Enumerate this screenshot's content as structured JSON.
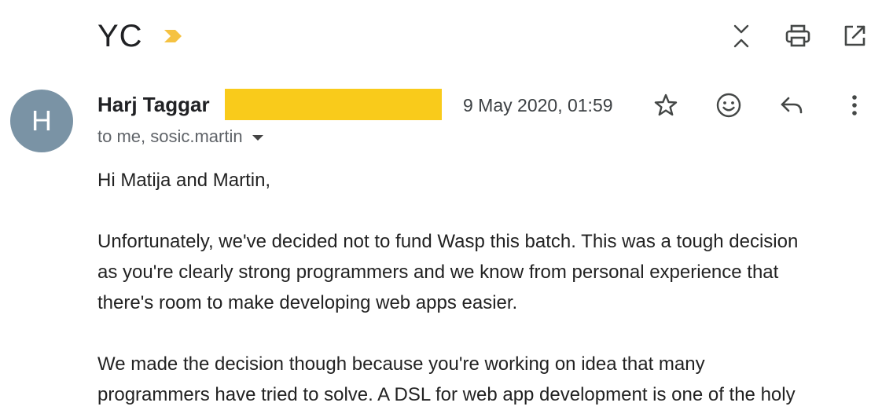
{
  "subject": {
    "title": "YC",
    "importance_marker": "importance-marker-icon"
  },
  "toolbar": {
    "icons": [
      "expand-collapse-icon",
      "print-icon",
      "open-in-new-window-icon"
    ]
  },
  "message": {
    "avatar_letter": "H",
    "sender_name": "Harj Taggar",
    "date": "9 May 2020, 01:59",
    "recipients": "to me, sosic.martin",
    "actions": [
      "star-icon",
      "emoji-reaction-icon",
      "reply-icon",
      "more-options-icon"
    ],
    "greeting": "Hi Matija and Martin,",
    "paragraph_1": "Unfortunately, we've decided not to fund Wasp this batch. This was a tough decision\nas you're clearly strong programmers and we know from personal experience that\nthere's room to make developing web apps easier.",
    "paragraph_2": "We made the decision though because you're working on idea that many\nprogrammers have tried to solve. A DSL for web app development is one of the holy"
  },
  "colors": {
    "avatar_bg": "#7a93a5",
    "redaction": "#f9cb1b",
    "importance": "#f5c242",
    "icon": "#444746"
  }
}
